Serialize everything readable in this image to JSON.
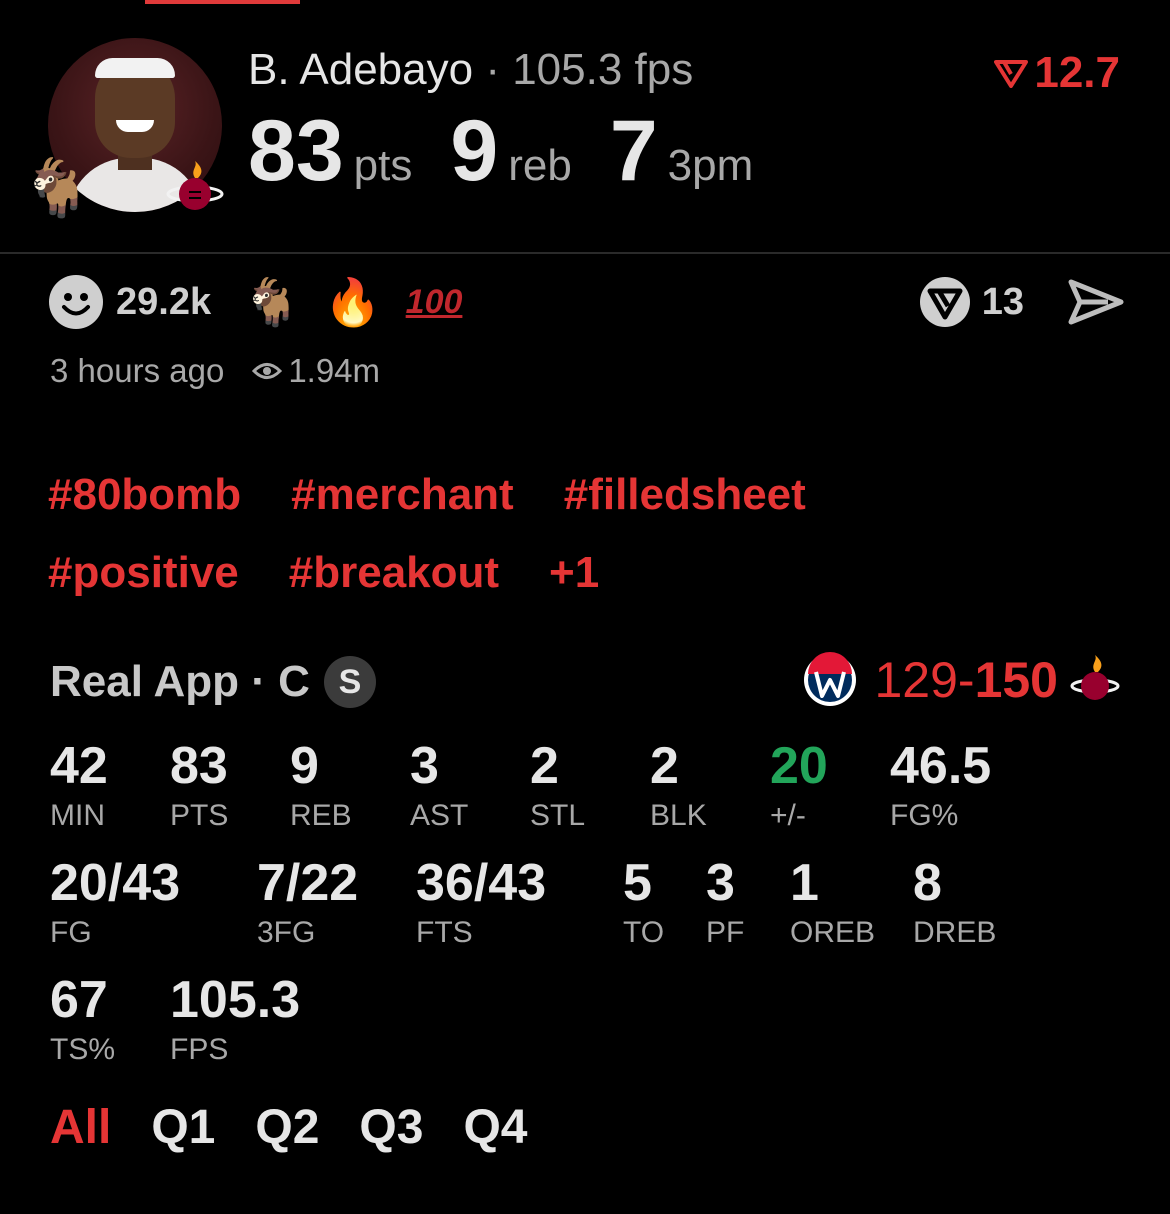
{
  "header": {
    "player_name": "B. Adebayo",
    "separator": "·",
    "fps_text": "105.3 fps",
    "headline_stats": [
      {
        "value": "83",
        "unit": "pts"
      },
      {
        "value": "9",
        "unit": "reb"
      },
      {
        "value": "7",
        "unit": "3pm"
      }
    ],
    "trend_value": "12.7",
    "trend_icon": "down-trend-icon",
    "avatar_icon": "player-avatar",
    "badge_icons": [
      "goat-emoji",
      "heat-team-logo"
    ]
  },
  "reactions": {
    "smile_count": "29.2k",
    "emojis": [
      "🐐",
      "🔥",
      "100"
    ],
    "vip_count": "13"
  },
  "meta": {
    "time_ago": "3 hours ago",
    "views": "1.94m"
  },
  "tags": {
    "row1": [
      "#80bomb",
      "#merchant",
      "#filledsheet"
    ],
    "row2": [
      "#positive",
      "#breakout",
      "+1"
    ]
  },
  "game": {
    "source": "Real App · C",
    "badge": "S",
    "away_score": "129",
    "dash": "-",
    "home_score": "150",
    "away_team_icon": "wizards-logo",
    "home_team_icon": "heat-logo"
  },
  "stats": {
    "min": {
      "value": "42",
      "label": "MIN"
    },
    "pts": {
      "value": "83",
      "label": "PTS"
    },
    "reb": {
      "value": "9",
      "label": "REB"
    },
    "ast": {
      "value": "3",
      "label": "AST"
    },
    "stl": {
      "value": "2",
      "label": "STL"
    },
    "blk": {
      "value": "2",
      "label": "BLK"
    },
    "pm": {
      "value": "20",
      "label": "+/-"
    },
    "fgp": {
      "value": "46.5",
      "label": "FG%"
    },
    "fg": {
      "value": "20/43",
      "label": "FG"
    },
    "fg3": {
      "value": "7/22",
      "label": "3FG"
    },
    "fts": {
      "value": "36/43",
      "label": "FTS"
    },
    "to": {
      "value": "5",
      "label": "TO"
    },
    "pf": {
      "value": "3",
      "label": "PF"
    },
    "oreb": {
      "value": "1",
      "label": "OREB"
    },
    "dreb": {
      "value": "8",
      "label": "DREB"
    },
    "tsp": {
      "value": "67",
      "label": "TS%"
    },
    "fps": {
      "value": "105.3",
      "label": "FPS"
    }
  },
  "tabs": [
    "All",
    "Q1",
    "Q2",
    "Q3",
    "Q4"
  ],
  "colors": {
    "accent_red": "#e53535",
    "positive_green": "#22a55a",
    "background": "#000000",
    "muted_text": "#a8a8a8"
  }
}
